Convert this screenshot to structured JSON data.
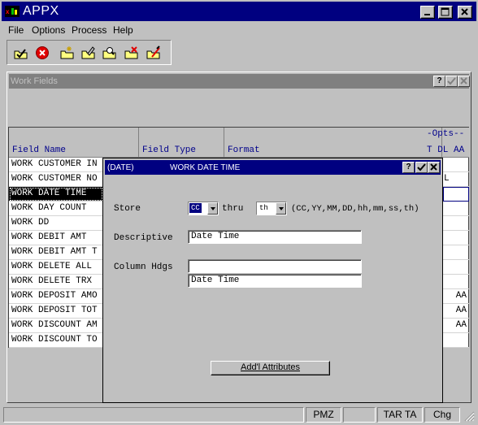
{
  "app": {
    "title": "APPX"
  },
  "menu": [
    "File",
    "Options",
    "Process",
    "Help"
  ],
  "toolbar": {
    "icons": [
      "check-folder-icon",
      "cancel-icon",
      "new-folder-icon",
      "edit-folder-icon",
      "search-folder-icon",
      "delete-folder-icon",
      "tools-folder-icon"
    ]
  },
  "work_fields": {
    "title": "Work Fields",
    "columns": {
      "field_name": "Field Name",
      "field_type": "Field Type",
      "format": "Format",
      "opts": "-Opts--",
      "opts_sub": "T DL AA"
    },
    "rows": [
      {
        "name": "WORK CUSTOMER IN",
        "opt": ""
      },
      {
        "name": "WORK CUSTOMER NO",
        "opt": "L"
      },
      {
        "name": "WORK DATE TIME",
        "opt": ""
      },
      {
        "name": "WORK DAY COUNT",
        "opt": ""
      },
      {
        "name": "WORK DD",
        "opt": ""
      },
      {
        "name": "WORK DEBIT AMT",
        "opt": ""
      },
      {
        "name": "WORK DEBIT AMT T",
        "opt": ""
      },
      {
        "name": "WORK DELETE ALL",
        "opt": ""
      },
      {
        "name": "WORK DELETE TRX",
        "opt": ""
      },
      {
        "name": "WORK DEPOSIT AMO",
        "opt": "AA"
      },
      {
        "name": "WORK DEPOSIT TOT",
        "opt": "AA"
      },
      {
        "name": "WORK DISCOUNT AM",
        "opt": "AA"
      },
      {
        "name": "WORK DISCOUNT TO",
        "opt": ""
      }
    ]
  },
  "dialog": {
    "tag": "(DATE)",
    "title": "WORK DATE TIME",
    "store_label": "Store",
    "store_from": "CC",
    "thru_label": "thru",
    "store_to": "th",
    "store_hint": "(CC,YY,MM,DD,hh,mm,ss,th)",
    "descriptive_label": "Descriptive",
    "descriptive_value": "Date Time",
    "column_hdgs_label": "Column Hdgs",
    "column_hdg_1": "",
    "column_hdg_2": "Date Time",
    "addl_button": "Add'l Attributes"
  },
  "status_bar": [
    "",
    "PMZ",
    "",
    "TAR TA",
    "Chg"
  ],
  "colors": {
    "title_active": "#000080",
    "title_inactive": "#808080",
    "face": "#c0c0c0",
    "column_text": "#00008b"
  }
}
